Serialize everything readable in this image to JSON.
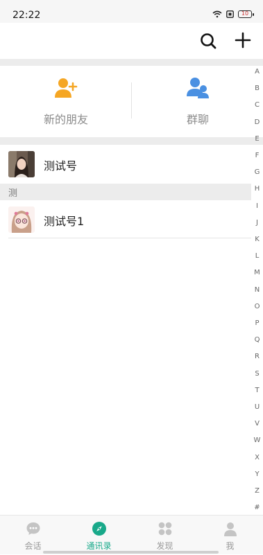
{
  "status": {
    "time": "22:22",
    "battery": "10"
  },
  "header": {
    "search_icon": "search-icon",
    "add_icon": "plus-icon"
  },
  "entries": [
    {
      "label": "新的朋友",
      "icon": "add-friend-icon",
      "color": "#f5a623"
    },
    {
      "label": "群聊",
      "icon": "group-icon",
      "color": "#4a90e2"
    }
  ],
  "contacts": [
    {
      "name": "测试号"
    },
    {
      "name": "测试号1"
    }
  ],
  "section": {
    "letter": "测"
  },
  "index_letters": [
    "A",
    "B",
    "C",
    "D",
    "E",
    "F",
    "G",
    "H",
    "I",
    "J",
    "K",
    "L",
    "M",
    "N",
    "O",
    "P",
    "Q",
    "R",
    "S",
    "T",
    "U",
    "V",
    "W",
    "X",
    "Y",
    "Z",
    "#"
  ],
  "nav": [
    {
      "label": "会话",
      "icon": "chat-icon"
    },
    {
      "label": "通讯录",
      "icon": "compass-icon",
      "active": true
    },
    {
      "label": "发现",
      "icon": "discover-icon"
    },
    {
      "label": "我",
      "icon": "person-icon"
    }
  ],
  "colors": {
    "accent": "#19a98a",
    "inactive": "#999999",
    "separator": "#ececec"
  }
}
